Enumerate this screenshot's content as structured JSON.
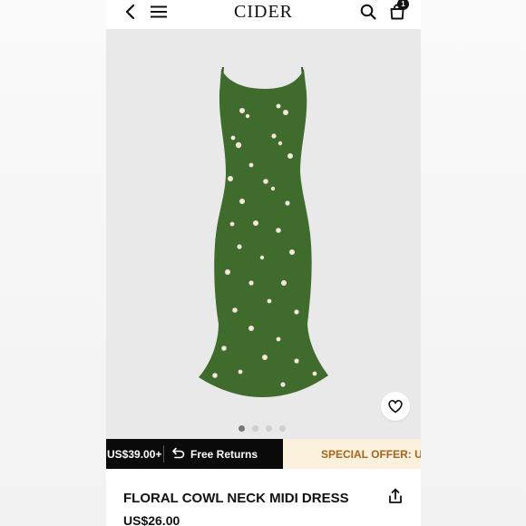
{
  "header": {
    "logo": "CIDER",
    "cart_count": "1",
    "icons": [
      "back-arrow-icon",
      "menu-icon",
      "search-icon",
      "shopping-bag-icon"
    ]
  },
  "gallery": {
    "dots_total": 4,
    "active_index": 0,
    "wishlist_icon": "heart-outline-icon"
  },
  "promo": {
    "threshold": "US$39.00+",
    "returns_label": "Free Returns",
    "returns_icon": "return-arrow-icon",
    "offer": "SPECIAL OFFER: UP"
  },
  "product": {
    "title": "FLORAL COWL NECK MIDI DRESS",
    "price": "US$26.00",
    "share_icon": "share-icon"
  },
  "colors": {
    "dress_green": "#3f6b2c",
    "promo_dark": "#0a0a0a",
    "promo_light_bg": "#fbf1dc",
    "promo_light_text": "#a7641c"
  }
}
